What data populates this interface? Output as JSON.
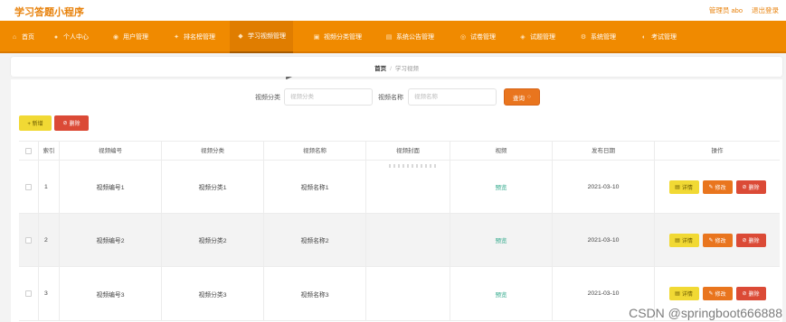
{
  "header": {
    "app_title": "学习答题小程序",
    "user_label": "管理员 abo",
    "logout_label": "退出登录"
  },
  "nav": {
    "items": [
      {
        "label": "首页",
        "icon": "home-icon"
      },
      {
        "label": "个人中心",
        "icon": "user-icon"
      },
      {
        "label": "用户管理",
        "icon": "users-icon"
      },
      {
        "label": "排名榜管理",
        "icon": "ranking-icon"
      },
      {
        "label": "学习视频管理",
        "icon": "video-icon"
      },
      {
        "label": "视频分类管理",
        "icon": "category-icon"
      },
      {
        "label": "系统公告管理",
        "icon": "notice-icon"
      },
      {
        "label": "试卷管理",
        "icon": "paper-icon"
      },
      {
        "label": "试题管理",
        "icon": "question-icon"
      },
      {
        "label": "系统管理",
        "icon": "settings-icon"
      },
      {
        "label": "考试管理",
        "icon": "exam-icon"
      }
    ],
    "active_index": 4
  },
  "breadcrumb": {
    "home": "首页",
    "sep": "/",
    "current": "学习视频"
  },
  "search": {
    "category_label": "视频分类",
    "category_placeholder": "视频分类",
    "name_label": "视频名称",
    "name_placeholder": "视频名称",
    "button_label": "查询"
  },
  "actions": {
    "add_label": "+ 新增",
    "delete_label": "删除"
  },
  "table": {
    "columns": [
      "索引",
      "视频编号",
      "视频分类",
      "视频名称",
      "视频封面",
      "视频",
      "发布日期",
      "操作"
    ],
    "rows": [
      {
        "index": "1",
        "code": "视频编号1",
        "category": "视频分类1",
        "name": "视频名称1",
        "video": "预览",
        "date": "2021-03-10"
      },
      {
        "index": "2",
        "code": "视频编号2",
        "category": "视频分类2",
        "name": "视频名称2",
        "video": "预览",
        "date": "2021-03-10"
      },
      {
        "index": "3",
        "code": "视频编号3",
        "category": "视频分类3",
        "name": "视频名称3",
        "video": "预览",
        "date": "2021-03-10"
      }
    ],
    "op_labels": {
      "detail": "详情",
      "edit": "修改",
      "delete": "删除"
    }
  },
  "watermark": "CSDN @springboot666888",
  "colors": {
    "brand": "#f08a00",
    "title": "#e8820c",
    "detail": "#f1d934",
    "edit": "#e9751e",
    "delete": "#db4a36",
    "preview": "#2fa88a"
  }
}
